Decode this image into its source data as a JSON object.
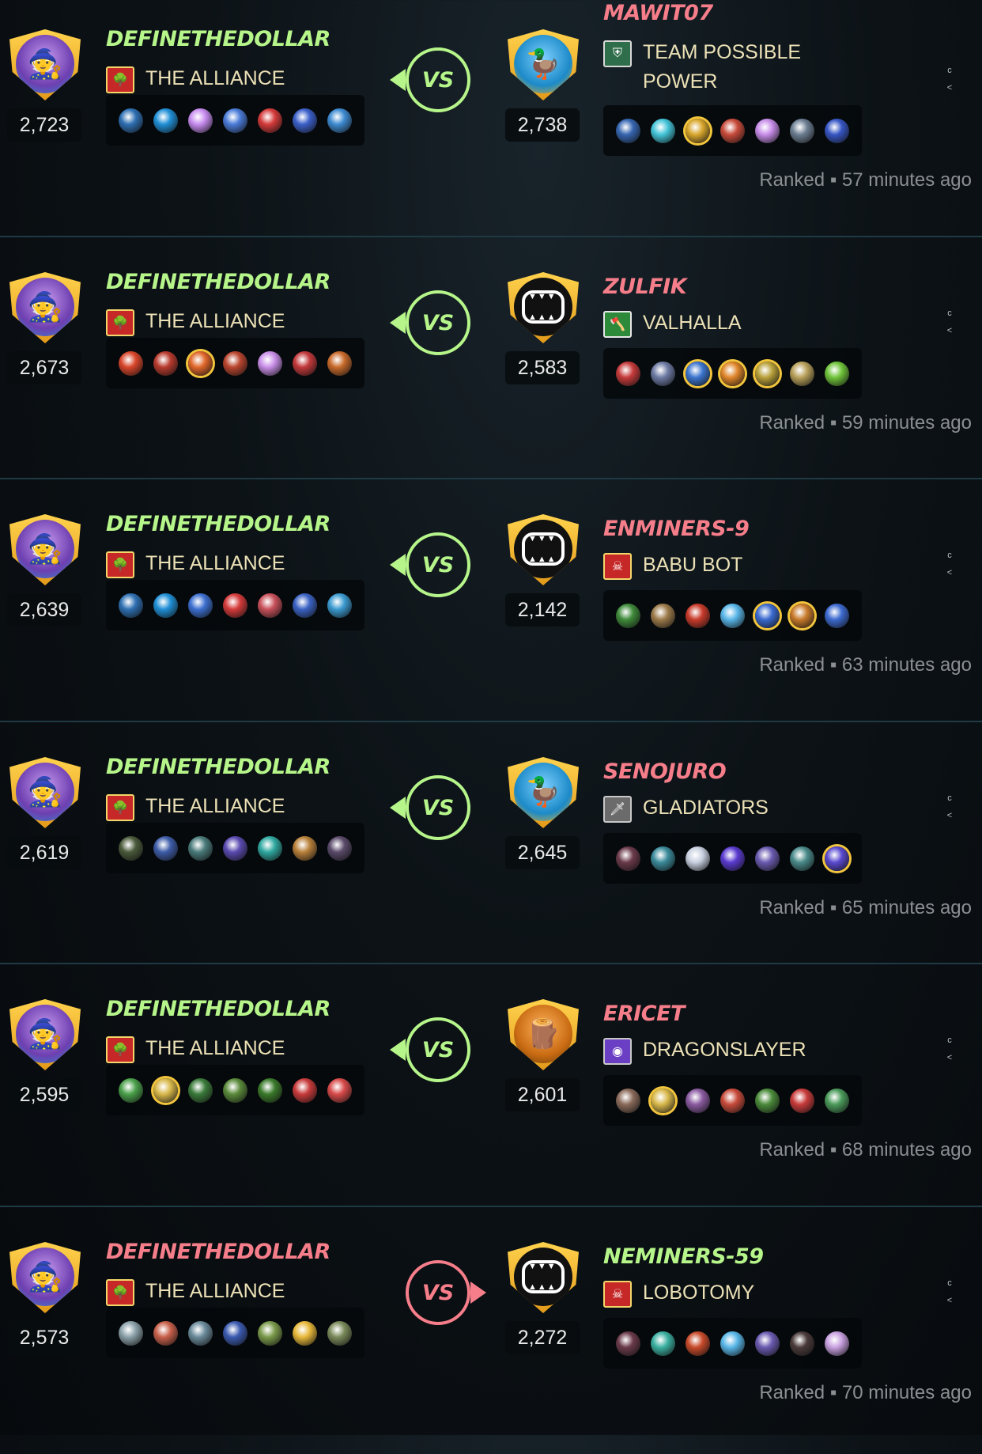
{
  "battles": [
    {
      "left": {
        "name": "DEFINETHEDOLLAR",
        "result": "win",
        "guild": "THE ALLIANCE",
        "rating": "2,723",
        "avatar": "wizard",
        "guild_icon": "tree-icon",
        "team": [
          "#2e6fb2",
          "#1f8fd6",
          "#c88cf0",
          "#4a7bd8",
          "#d53a3a",
          "#3b5fc9",
          "#3d8ad1"
        ]
      },
      "vs": "VS",
      "right": {
        "name": "MAWIT07",
        "result": "lose",
        "guild": "TEAM POSSIBLE POWER",
        "rating": "2,738",
        "avatar": "duck",
        "guild_icon": "shield-icon",
        "team": [
          "#3565b0",
          "#43c4d8",
          "#d8a62c",
          "#c84a3a",
          "#c78ce8",
          "#6c7e92",
          "#3656c4"
        ],
        "gold": [
          2
        ]
      },
      "meta": "Ranked ▪ 57 minutes ago"
    },
    {
      "left": {
        "name": "DEFINETHEDOLLAR",
        "result": "win",
        "guild": "THE ALLIANCE",
        "rating": "2,673",
        "avatar": "wizard",
        "guild_icon": "tree-icon",
        "team": [
          "#d8452a",
          "#b83a2d",
          "#e0662a",
          "#b9452e",
          "#c98ee8",
          "#c2383a",
          "#c86a2a"
        ],
        "gold": [
          2
        ]
      },
      "vs": "VS",
      "right": {
        "name": "ZULFIK",
        "result": "lose",
        "guild": "VALHALLA",
        "rating": "2,583",
        "avatar": "mouth",
        "guild_icon": "axe-icon",
        "team": [
          "#c63a3a",
          "#6d7aa3",
          "#3c75cf",
          "#e0862a",
          "#b8a03a",
          "#b8a05a",
          "#6fc43a"
        ],
        "gold": [
          2,
          3,
          4
        ]
      },
      "meta": "Ranked ▪ 59 minutes ago"
    },
    {
      "left": {
        "name": "DEFINETHEDOLLAR",
        "result": "win",
        "guild": "THE ALLIANCE",
        "rating": "2,639",
        "avatar": "wizard",
        "guild_icon": "tree-icon",
        "team": [
          "#2e6fb2",
          "#1f8fd6",
          "#3c6fd0",
          "#d53a3a",
          "#c8505a",
          "#3a62c4",
          "#3a9ad0"
        ]
      },
      "vs": "VS",
      "right": {
        "name": "ENMINERS-9",
        "result": "lose",
        "guild": "BABU BOT",
        "rating": "2,142",
        "avatar": "mouth",
        "guild_icon": "skull-icon",
        "team": [
          "#3f8a3a",
          "#9c7a4a",
          "#c83a2a",
          "#58b6e8",
          "#3a6ad0",
          "#c87a2a",
          "#3c6ad0"
        ],
        "gold": [
          4,
          5
        ]
      },
      "meta": "Ranked ▪ 63 minutes ago"
    },
    {
      "left": {
        "name": "DEFINETHEDOLLAR",
        "result": "win",
        "guild": "THE ALLIANCE",
        "rating": "2,619",
        "avatar": "wizard",
        "guild_icon": "tree-icon",
        "team": [
          "#4a5a3a",
          "#3d5ca8",
          "#4a7a7a",
          "#5a4ab0",
          "#2fa8a0",
          "#b8803a",
          "#5a4a6a"
        ]
      },
      "vs": "VS",
      "right": {
        "name": "SENOJURO",
        "result": "lose",
        "guild": "GLADIATORS",
        "rating": "2,645",
        "avatar": "duck",
        "guild_icon": "sword-icon",
        "team": [
          "#6a3a4a",
          "#3a8a9a",
          "#c8d0e0",
          "#5a3ad0",
          "#6a5ab0",
          "#4a8a8a",
          "#5a4ad0"
        ],
        "gold": [
          6
        ]
      },
      "meta": "Ranked ▪ 65 minutes ago"
    },
    {
      "left": {
        "name": "DEFINETHEDOLLAR",
        "result": "win",
        "guild": "THE ALLIANCE",
        "rating": "2,595",
        "avatar": "wizard",
        "guild_icon": "tree-icon",
        "team": [
          "#4aa04a",
          "#d8b84a",
          "#3a7a3a",
          "#5a8a3a",
          "#3a7a2a",
          "#c83a3a",
          "#d84a4a"
        ],
        "gold": [
          1
        ]
      },
      "vs": "VS",
      "right": {
        "name": "ERICET",
        "result": "lose",
        "guild": "DRAGONSLAYER",
        "rating": "2,601",
        "avatar": "orange",
        "guild_icon": "orb-icon",
        "team": [
          "#8a6a5a",
          "#d8b84a",
          "#8a5aa0",
          "#c84a3a",
          "#4a8a3a",
          "#c83a3a",
          "#4a9a5a"
        ],
        "gold": [
          1
        ]
      },
      "meta": "Ranked ▪ 68 minutes ago"
    },
    {
      "left": {
        "name": "DEFINETHEDOLLAR",
        "result": "lose",
        "guild": "THE ALLIANCE",
        "rating": "2,573",
        "avatar": "wizard",
        "guild_icon": "tree-icon",
        "team": [
          "#8aa0a8",
          "#c8604a",
          "#6a8a9a",
          "#3a5ab0",
          "#7a9a4a",
          "#e8b83a",
          "#7a8a5a"
        ]
      },
      "vs": "VS",
      "right": {
        "name": "NEMINERS-59",
        "result": "win",
        "guild": "LOBOTOMY",
        "rating": "2,272",
        "avatar": "mouth",
        "guild_icon": "skull-icon",
        "team": [
          "#6a3a4a",
          "#3ab0a0",
          "#c84a2a",
          "#58b6e8",
          "#6a5ab0",
          "#4a3a3a",
          "#c8a0e0"
        ]
      },
      "meta": "Ranked ▪ 70 minutes ago"
    }
  ]
}
